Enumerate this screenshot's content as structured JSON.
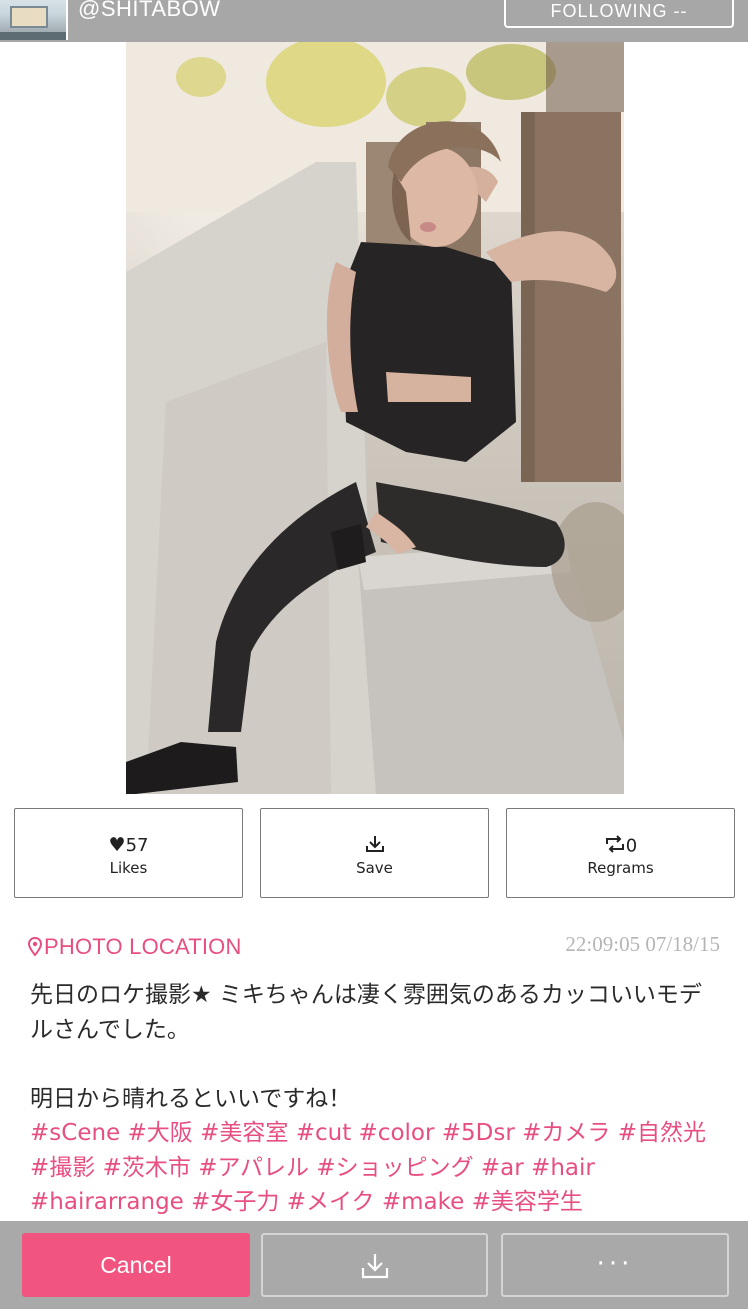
{
  "header": {
    "username": "@SHITABOW",
    "follow_label": "FOLLOWING --"
  },
  "post": {
    "image_alt": "Fashion photo of a model sitting on a stone ledge by a wooden fence",
    "likes_count": "57",
    "likes_label": "Likes",
    "save_label": "Save",
    "regrams_count": "0",
    "regrams_label": "Regrams",
    "location_label": "PHOTO LOCATION",
    "timestamp": "22:09:05 07/18/15",
    "caption_line1": "先日のロケ撮影★  ミキちゃんは凄く雰囲気のあるカッコいいモデルさんでした。",
    "caption_line2": "明日から晴れるといいですね！",
    "hashtags": [
      "#sCene",
      "#大阪",
      "#美容室",
      "#cut",
      "#color",
      " #5Dsr",
      "#カメラ",
      "#自然光",
      "#撮影",
      "#茨木市",
      "#アパレル",
      " #ショッピング",
      "#ar",
      "#hair",
      "#hairarrange",
      "#女子力",
      "#メイク",
      "#make",
      "#美容学生"
    ]
  },
  "bottom_bar": {
    "cancel_label": "Cancel",
    "more_label": "···"
  },
  "icons": {
    "heart": "heart-icon",
    "save": "download-icon",
    "regram": "repost-icon",
    "location": "location-pin-icon",
    "more": "more-dots-icon"
  },
  "colors": {
    "accent_pink": "#e84f80",
    "cancel_pink": "#f0547f",
    "bar_gray": "#a9a9a9",
    "header_gray": "#a7a7a7"
  }
}
